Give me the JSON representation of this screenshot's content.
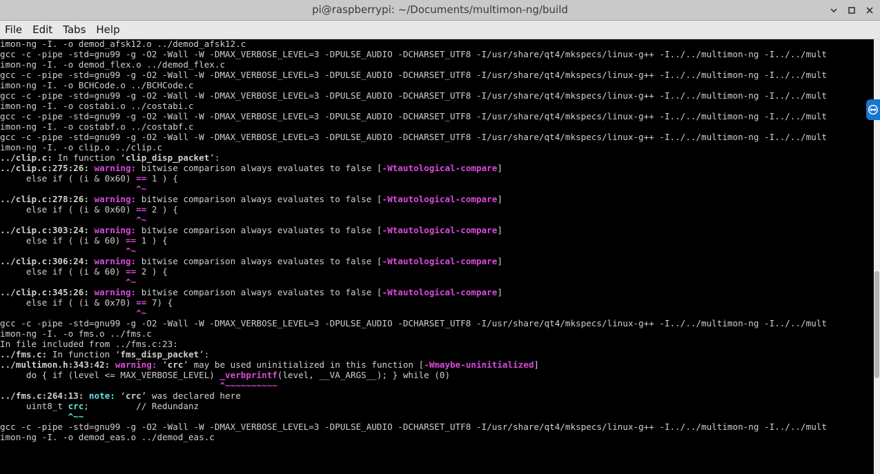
{
  "window": {
    "title": "pi@raspberrypi: ~/Documents/multimon-ng/build",
    "controls": [
      "minimize",
      "maximize",
      "close"
    ]
  },
  "menu": [
    "File",
    "Edit",
    "Tabs",
    "Help"
  ],
  "colors": {
    "text": "#d0d0d0",
    "warning": "#d84bd8",
    "note": "#5fe6e6",
    "caret": "#32d232",
    "highlight": "#d84bd8",
    "background": "#000000",
    "teamviewer": "#1677cf"
  },
  "terminal": {
    "lines": [
      [
        {
          "t": "imon-ng -I. -o demod_afsk12.o ../demod_afsk12.c"
        }
      ],
      [
        {
          "t": "gcc -c -pipe -std=gnu99 -g -O2 -Wall -W -DMAX_VERBOSE_LEVEL=3 -DPULSE_AUDIO -DCHARSET_UTF8 -I/usr/share/qt4/mkspecs/linux-g++ -I../../multimon-ng -I../../mult"
        }
      ],
      [
        {
          "t": "imon-ng -I. -o demod_flex.o ../demod_flex.c"
        }
      ],
      [
        {
          "t": "gcc -c -pipe -std=gnu99 -g -O2 -Wall -W -DMAX_VERBOSE_LEVEL=3 -DPULSE_AUDIO -DCHARSET_UTF8 -I/usr/share/qt4/mkspecs/linux-g++ -I../../multimon-ng -I../../mult"
        }
      ],
      [
        {
          "t": "imon-ng -I. -o BCHCode.o ../BCHCode.c"
        }
      ],
      [
        {
          "t": "gcc -c -pipe -std=gnu99 -g -O2 -Wall -W -DMAX_VERBOSE_LEVEL=3 -DPULSE_AUDIO -DCHARSET_UTF8 -I/usr/share/qt4/mkspecs/linux-g++ -I../../multimon-ng -I../../mult"
        }
      ],
      [
        {
          "t": "imon-ng -I. -o costabi.o ../costabi.c"
        }
      ],
      [
        {
          "t": "gcc -c -pipe -std=gnu99 -g -O2 -Wall -W -DMAX_VERBOSE_LEVEL=3 -DPULSE_AUDIO -DCHARSET_UTF8 -I/usr/share/qt4/mkspecs/linux-g++ -I../../multimon-ng -I../../mult"
        }
      ],
      [
        {
          "t": "imon-ng -I. -o costabf.o ../costabf.c"
        }
      ],
      [
        {
          "t": "gcc -c -pipe -std=gnu99 -g -O2 -Wall -W -DMAX_VERBOSE_LEVEL=3 -DPULSE_AUDIO -DCHARSET_UTF8 -I/usr/share/qt4/mkspecs/linux-g++ -I../../multimon-ng -I../../mult"
        }
      ],
      [
        {
          "t": "imon-ng -I. -o clip.o ../clip.c"
        }
      ],
      [
        {
          "t": "../clip.c:",
          "b": 1
        },
        {
          "t": " In function ‘"
        },
        {
          "t": "clip_disp_packet",
          "b": 1
        },
        {
          "t": "’:"
        }
      ],
      [
        {
          "t": "../clip.c:275:26: ",
          "b": 1
        },
        {
          "t": "warning: ",
          "b": 1,
          "c": "warning"
        },
        {
          "t": "bitwise comparison always evaluates to false ["
        },
        {
          "t": "-Wtautological-compare",
          "b": 1,
          "c": "warning"
        },
        {
          "t": "]"
        }
      ],
      [
        {
          "t": "     else if ( (i & 0x60) "
        },
        {
          "t": "==",
          "b": 1,
          "c": "highlight"
        },
        {
          "t": " 1 ) {"
        }
      ],
      [
        {
          "t": "                          "
        },
        {
          "t": "^~",
          "b": 1,
          "c": "highlight"
        }
      ],
      [
        {
          "t": "../clip.c:278:26: ",
          "b": 1
        },
        {
          "t": "warning: ",
          "b": 1,
          "c": "warning"
        },
        {
          "t": "bitwise comparison always evaluates to false ["
        },
        {
          "t": "-Wtautological-compare",
          "b": 1,
          "c": "warning"
        },
        {
          "t": "]"
        }
      ],
      [
        {
          "t": "     else if ( (i & 0x60) "
        },
        {
          "t": "==",
          "b": 1,
          "c": "highlight"
        },
        {
          "t": " 2 ) {"
        }
      ],
      [
        {
          "t": "                          "
        },
        {
          "t": "^~",
          "b": 1,
          "c": "highlight"
        }
      ],
      [
        {
          "t": "../clip.c:303:24: ",
          "b": 1
        },
        {
          "t": "warning: ",
          "b": 1,
          "c": "warning"
        },
        {
          "t": "bitwise comparison always evaluates to false ["
        },
        {
          "t": "-Wtautological-compare",
          "b": 1,
          "c": "warning"
        },
        {
          "t": "]"
        }
      ],
      [
        {
          "t": "     else if ( (i & 60) "
        },
        {
          "t": "==",
          "b": 1,
          "c": "highlight"
        },
        {
          "t": " 1 ) {"
        }
      ],
      [
        {
          "t": "                        "
        },
        {
          "t": "^~",
          "b": 1,
          "c": "highlight"
        }
      ],
      [
        {
          "t": "../clip.c:306:24: ",
          "b": 1
        },
        {
          "t": "warning: ",
          "b": 1,
          "c": "warning"
        },
        {
          "t": "bitwise comparison always evaluates to false ["
        },
        {
          "t": "-Wtautological-compare",
          "b": 1,
          "c": "warning"
        },
        {
          "t": "]"
        }
      ],
      [
        {
          "t": "     else if ( (i & 60) "
        },
        {
          "t": "==",
          "b": 1,
          "c": "highlight"
        },
        {
          "t": " 2 ) {"
        }
      ],
      [
        {
          "t": "                        "
        },
        {
          "t": "^~",
          "b": 1,
          "c": "highlight"
        }
      ],
      [
        {
          "t": "../clip.c:345:26: ",
          "b": 1
        },
        {
          "t": "warning: ",
          "b": 1,
          "c": "warning"
        },
        {
          "t": "bitwise comparison always evaluates to false ["
        },
        {
          "t": "-Wtautological-compare",
          "b": 1,
          "c": "warning"
        },
        {
          "t": "]"
        }
      ],
      [
        {
          "t": "     else if ( (i & 0x70) "
        },
        {
          "t": "==",
          "b": 1,
          "c": "highlight"
        },
        {
          "t": " 7) {"
        }
      ],
      [
        {
          "t": "                          "
        },
        {
          "t": "^~",
          "b": 1,
          "c": "highlight"
        }
      ],
      [
        {
          "t": "gcc -c -pipe -std=gnu99 -g -O2 -Wall -W -DMAX_VERBOSE_LEVEL=3 -DPULSE_AUDIO -DCHARSET_UTF8 -I/usr/share/qt4/mkspecs/linux-g++ -I../../multimon-ng -I../../mult"
        }
      ],
      [
        {
          "t": "imon-ng -I. -o fms.o ../fms.c"
        }
      ],
      [
        {
          "t": "In file included from ../fms.c:23:"
        }
      ],
      [
        {
          "t": "../fms.c:",
          "b": 1
        },
        {
          "t": " In function ‘"
        },
        {
          "t": "fms_disp_packet",
          "b": 1
        },
        {
          "t": "’:"
        }
      ],
      [
        {
          "t": "../multimon.h:343:42: ",
          "b": 1
        },
        {
          "t": "warning: ",
          "b": 1,
          "c": "warning"
        },
        {
          "t": "‘"
        },
        {
          "t": "crc",
          "b": 1
        },
        {
          "t": "’ may be used uninitialized in this function ["
        },
        {
          "t": "-Wmaybe-uninitialized",
          "b": 1,
          "c": "warning"
        },
        {
          "t": "]"
        }
      ],
      [
        {
          "t": "     do { if (level <= MAX_VERBOSE_LEVEL) "
        },
        {
          "t": "_verbprintf",
          "b": 1,
          "c": "highlight"
        },
        {
          "t": "(level, __VA_ARGS__); } while (0)"
        }
      ],
      [
        {
          "t": "                                          "
        },
        {
          "t": "^~~~~~~~~~~",
          "b": 1,
          "c": "highlight"
        }
      ],
      [
        {
          "t": "../fms.c:264:13: ",
          "b": 1
        },
        {
          "t": "note: ",
          "b": 1,
          "c": "note"
        },
        {
          "t": "‘"
        },
        {
          "t": "crc",
          "b": 1
        },
        {
          "t": "’ was declared here"
        }
      ],
      [
        {
          "t": "     uint8_t "
        },
        {
          "t": "crc",
          "b": 1,
          "c": "note"
        },
        {
          "t": ";         // Redundanz"
        }
      ],
      [
        {
          "t": "             "
        },
        {
          "t": "^~~",
          "b": 1,
          "c": "note"
        }
      ],
      [
        {
          "t": "gcc -c -pipe -std=gnu99 -g -O2 -Wall -W -DMAX_VERBOSE_LEVEL=3 -DPULSE_AUDIO -DCHARSET_UTF8 -I/usr/share/qt4/mkspecs/linux-g++ -I../../multimon-ng -I../../mult"
        }
      ],
      [
        {
          "t": "imon-ng -I. -o demod_eas.o ../demod_eas.c"
        }
      ]
    ]
  },
  "scrollbar": {
    "position_fraction": 0.95
  },
  "icons": {
    "side_tab": "teamviewer-icon"
  }
}
